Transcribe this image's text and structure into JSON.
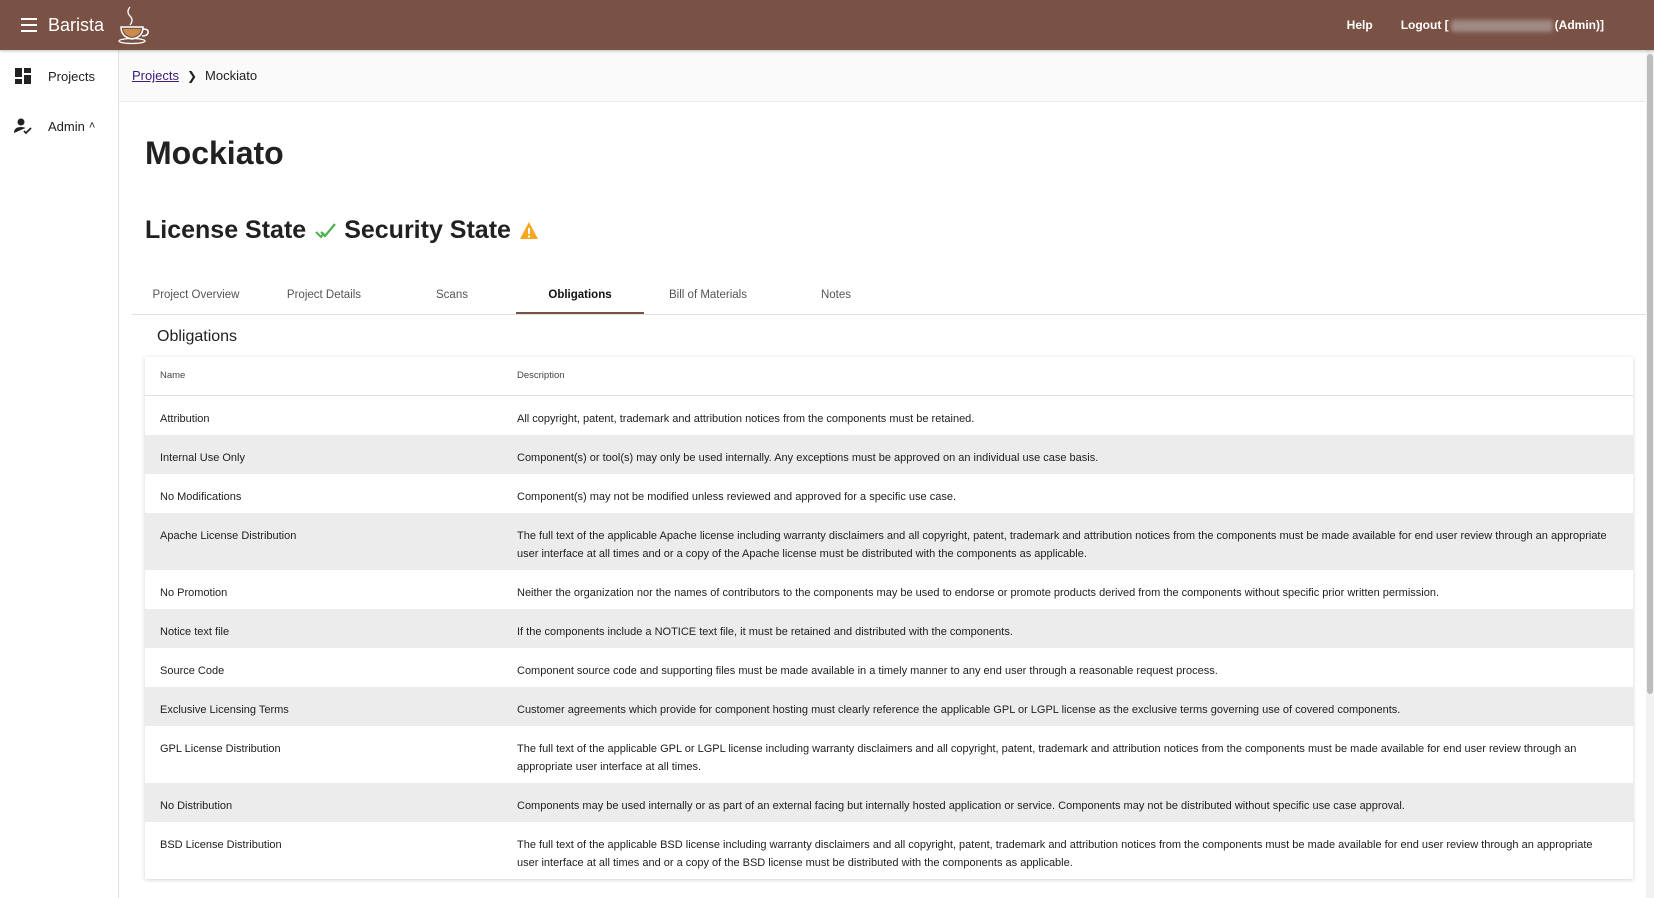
{
  "app": {
    "name": "Barista"
  },
  "header": {
    "help": "Help",
    "logout_prefix": "Logout [",
    "logout_suffix": "(Admin)]"
  },
  "sidebar": {
    "items": [
      {
        "label": "Projects",
        "icon": "dashboard-icon"
      },
      {
        "label": "Admin",
        "icon": "admin-user-icon"
      }
    ]
  },
  "breadcrumb": {
    "parent": "Projects",
    "current": "Mockiato"
  },
  "project": {
    "title": "Mockiato",
    "license_state": "License State",
    "security_state": "Security State"
  },
  "tabs": [
    "Project Overview",
    "Project Details",
    "Scans",
    "Obligations",
    "Bill of Materials",
    "Notes"
  ],
  "active_tab": "Obligations",
  "obligations": {
    "title": "Obligations",
    "columns": [
      "Name",
      "Description"
    ],
    "rows": [
      {
        "name": "Attribution",
        "description": "All copyright, patent, trademark and attribution notices from the components must be retained."
      },
      {
        "name": "Internal Use Only",
        "description": "Component(s) or tool(s) may only be used internally. Any exceptions must be approved on an individual use case basis."
      },
      {
        "name": "No Modifications",
        "description": "Component(s) may not be modified unless reviewed and approved for a specific use case."
      },
      {
        "name": "Apache License Distribution",
        "description": "The full text of the applicable Apache license including warranty disclaimers and all copyright, patent, trademark and attribution notices from the components must be made available for end user review through an appropriate user interface at all times and or a copy of the Apache license must be distributed with the components as applicable."
      },
      {
        "name": "No Promotion",
        "description": "Neither the organization nor the names of contributors to the components may be used to endorse or promote products derived from the components without specific prior written permission."
      },
      {
        "name": "Notice text file",
        "description": "If the components include a NOTICE text file, it must be retained and distributed with the components."
      },
      {
        "name": "Source Code",
        "description": "Component source code and supporting files must be made available in a timely manner to any end user through a reasonable request process."
      },
      {
        "name": "Exclusive Licensing Terms",
        "description": "Customer agreements which provide for component hosting must clearly reference the applicable GPL or LGPL license as the exclusive terms governing use of covered components."
      },
      {
        "name": "GPL License Distribution",
        "description": "The full text of the applicable GPL or LGPL license including warranty disclaimers and all copyright, patent, trademark and attribution notices from the components must be made available for end user review through an appropriate user interface at all times."
      },
      {
        "name": "No Distribution",
        "description": "Components may be used internally or as part of an external facing but internally hosted application or service. Components may not be distributed without specific use case approval."
      },
      {
        "name": "BSD License Distribution",
        "description": "The full text of the applicable BSD license including warranty disclaimers and all copyright, patent, trademark and attribution notices from the components must be made available for end user review through an appropriate user interface at all times and or a copy of the BSD license must be distributed with the components as applicable."
      }
    ]
  },
  "colors": {
    "brand": "#7a5145",
    "license_ok": "#4caf50",
    "security_warning": "#f5a623",
    "link": "#3d1a7a"
  }
}
